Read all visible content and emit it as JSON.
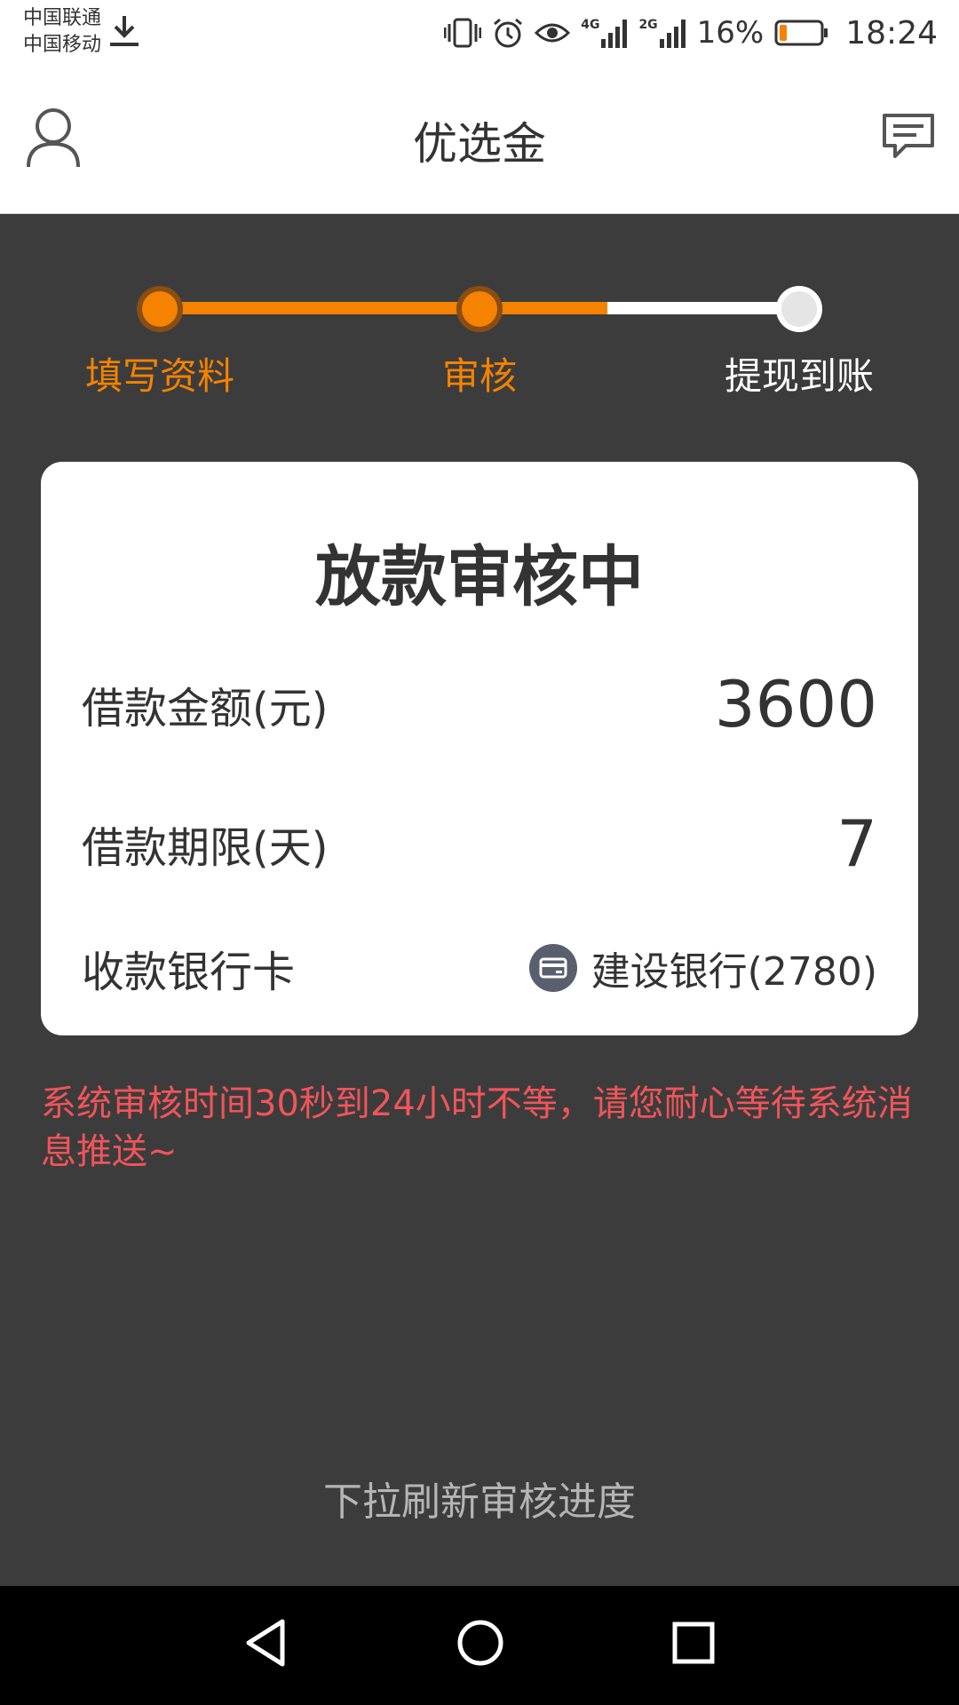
{
  "status_bar": {
    "carrier_1": "中国联通",
    "carrier_2": "中国移动",
    "network_4g": "4G",
    "network_2g": "2G",
    "battery": "16%",
    "time": "18:24"
  },
  "header": {
    "title": "优选金",
    "left_icon": "user-icon",
    "right_icon": "message-icon"
  },
  "progress": {
    "steps": [
      {
        "label": "填写资料",
        "state": "done"
      },
      {
        "label": "审核",
        "state": "done"
      },
      {
        "label": "提现到账",
        "state": "todo"
      }
    ],
    "fraction_complete": 0.7
  },
  "card": {
    "title": "放款审核中",
    "amount_label": "借款金额(元)",
    "amount_value": "3600",
    "term_label": "借款期限(天)",
    "term_value": "7",
    "bank_label": "收款银行卡",
    "bank_value": "建设银行(2780)",
    "bank_icon": "card-icon"
  },
  "notice": "系统审核时间30秒到24小时不等，请您耐心等待系统消息推送~",
  "refresh_hint": "下拉刷新审核进度",
  "colors": {
    "accent": "#f58200",
    "notice": "#f0555a",
    "background": "#3c3c3c"
  }
}
